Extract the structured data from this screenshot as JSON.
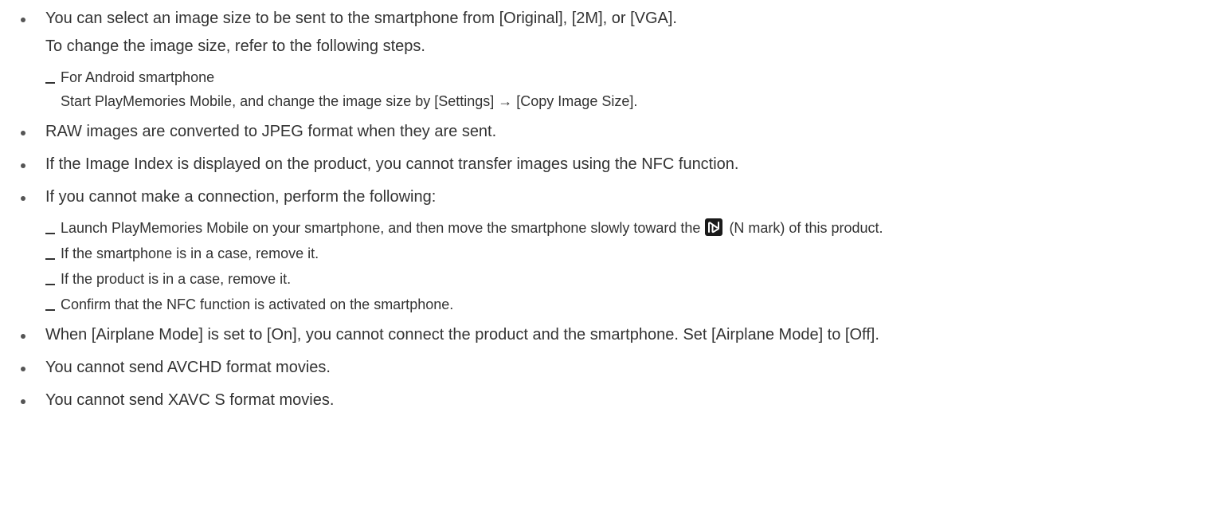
{
  "items": [
    {
      "text": "You can select an image size to be sent to the smartphone from [Original], [2M], or [VGA].",
      "note": "To change the image size, refer to the following steps.",
      "sub": [
        {
          "line1": "For Android smartphone",
          "line2": "Start PlayMemories Mobile, and change the image size by [Settings] → [Copy Image Size]."
        }
      ]
    },
    {
      "text": "RAW images are converted to JPEG format when they are sent."
    },
    {
      "text": "If the Image Index is displayed on the product, you cannot transfer images using the NFC function."
    },
    {
      "text": "If you cannot make a connection, perform the following:",
      "sub": [
        {
          "before_icon": "Launch PlayMemories Mobile on your smartphone, and then move the smartphone slowly toward the",
          "icon": "nfc-n-mark-icon",
          "after_icon": "(N mark) of this product."
        },
        {
          "line1": "If the smartphone is in a case, remove it."
        },
        {
          "line1": "If the product is in a case, remove it."
        },
        {
          "line1": "Confirm that the NFC function is activated on the smartphone."
        }
      ]
    },
    {
      "text": "When [Airplane Mode] is set to [On], you cannot connect the product and the smartphone. Set [Airplane Mode] to [Off]."
    },
    {
      "text": "You cannot send AVCHD format movies."
    },
    {
      "text": "You cannot send XAVC S format movies."
    }
  ]
}
